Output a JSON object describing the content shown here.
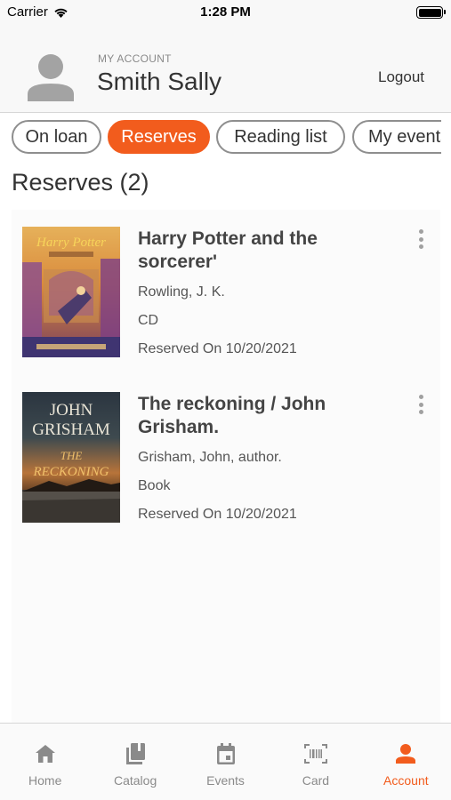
{
  "status_bar": {
    "carrier": "Carrier",
    "time": "1:28 PM"
  },
  "account": {
    "kicker": "MY ACCOUNT",
    "name": "Smith Sally",
    "logout_label": "Logout"
  },
  "tabs": [
    {
      "label": "On loan",
      "active": false
    },
    {
      "label": "Reserves",
      "active": true
    },
    {
      "label": "Reading list",
      "active": false
    },
    {
      "label": "My events",
      "active": false
    }
  ],
  "section": {
    "title": "Reserves (2)"
  },
  "items": [
    {
      "title": "Harry Potter and the sorcerer'",
      "author": "Rowling, J. K.",
      "format": "CD",
      "reserved": "Reserved On 10/20/2021",
      "cover_text": "Harry Potter"
    },
    {
      "title": "The reckoning / John Grisham.",
      "author": "Grisham, John, author.",
      "format": "Book",
      "reserved": "Reserved On 10/20/2021",
      "cover_line1": "JOHN",
      "cover_line2": "GRISHAM",
      "cover_line3": "THE",
      "cover_line4": "RECKONING"
    }
  ],
  "nav": [
    {
      "label": "Home",
      "icon": "home-icon",
      "active": false
    },
    {
      "label": "Catalog",
      "icon": "catalog-icon",
      "active": false
    },
    {
      "label": "Events",
      "icon": "calendar-icon",
      "active": false
    },
    {
      "label": "Card",
      "icon": "barcode-icon",
      "active": false
    },
    {
      "label": "Account",
      "icon": "person-icon",
      "active": true
    }
  ],
  "colors": {
    "accent": "#f25c1d",
    "text": "#333333",
    "muted": "#8a8a8a"
  }
}
